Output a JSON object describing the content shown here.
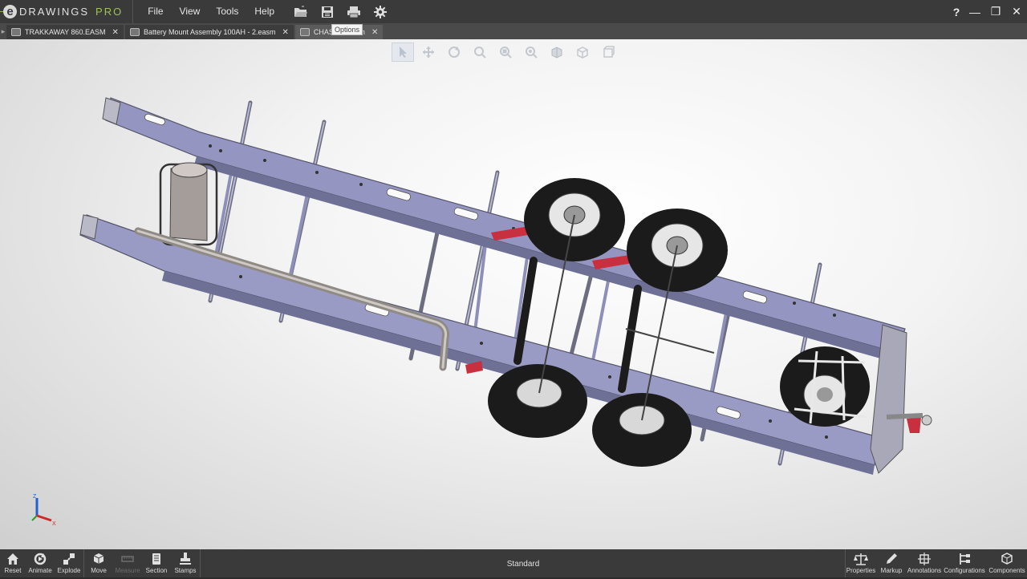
{
  "app": {
    "logo_text": "DRAWINGS",
    "logo_pro": "PRO",
    "logo_e": "e"
  },
  "menu": [
    "File",
    "View",
    "Tools",
    "Help"
  ],
  "quick_access": [
    "open-icon",
    "save-icon",
    "print-icon",
    "options-gear-icon"
  ],
  "tooltip": "Options",
  "help_label": "?",
  "window_controls": {
    "minimize": "—",
    "restore": "❐",
    "close": "✕"
  },
  "tabs": [
    {
      "label": "TRAKKAWAY 860.EASM",
      "close": "✕",
      "active": false
    },
    {
      "label": "Battery Mount Assembly 100AH - 2.easm",
      "close": "✕",
      "active": false
    },
    {
      "label": "CHASSIS.easm",
      "close": "✕",
      "active": true
    }
  ],
  "view_toolbar": [
    "select-icon",
    "pan-icon",
    "rotate-icon",
    "zoom-icon",
    "zoom-to-area-icon",
    "zoom-to-fit-icon",
    "view-orientation-icon",
    "display-style-icon",
    "section-view-icon"
  ],
  "triad": {
    "x": "X",
    "y": "Y",
    "z": "Z"
  },
  "bottom_left": [
    {
      "label": "Reset",
      "icon": "home-icon",
      "enabled": true
    },
    {
      "label": "Animate",
      "icon": "animate-icon",
      "enabled": true
    },
    {
      "label": "Explode",
      "icon": "explode-icon",
      "enabled": true
    },
    {
      "label": "Move",
      "icon": "move-icon",
      "enabled": true
    },
    {
      "label": "Measure",
      "icon": "measure-icon",
      "enabled": false
    },
    {
      "label": "Section",
      "icon": "section-icon",
      "enabled": true
    },
    {
      "label": "Stamps",
      "icon": "stamp-icon",
      "enabled": true
    }
  ],
  "status_center": "Standard",
  "bottom_right": [
    {
      "label": "Properties",
      "icon": "properties-icon"
    },
    {
      "label": "Markup",
      "icon": "pencil-icon"
    },
    {
      "label": "Annotations",
      "icon": "annotations-icon"
    },
    {
      "label": "Configurations",
      "icon": "configurations-icon"
    },
    {
      "label": "Components",
      "icon": "components-icon"
    }
  ],
  "colors": {
    "titlebar": "#3a3a3a",
    "accent": "#9cc05a",
    "frame": "#8e8fb8",
    "tire": "#1b1b1b",
    "spring_red": "#c83040"
  }
}
